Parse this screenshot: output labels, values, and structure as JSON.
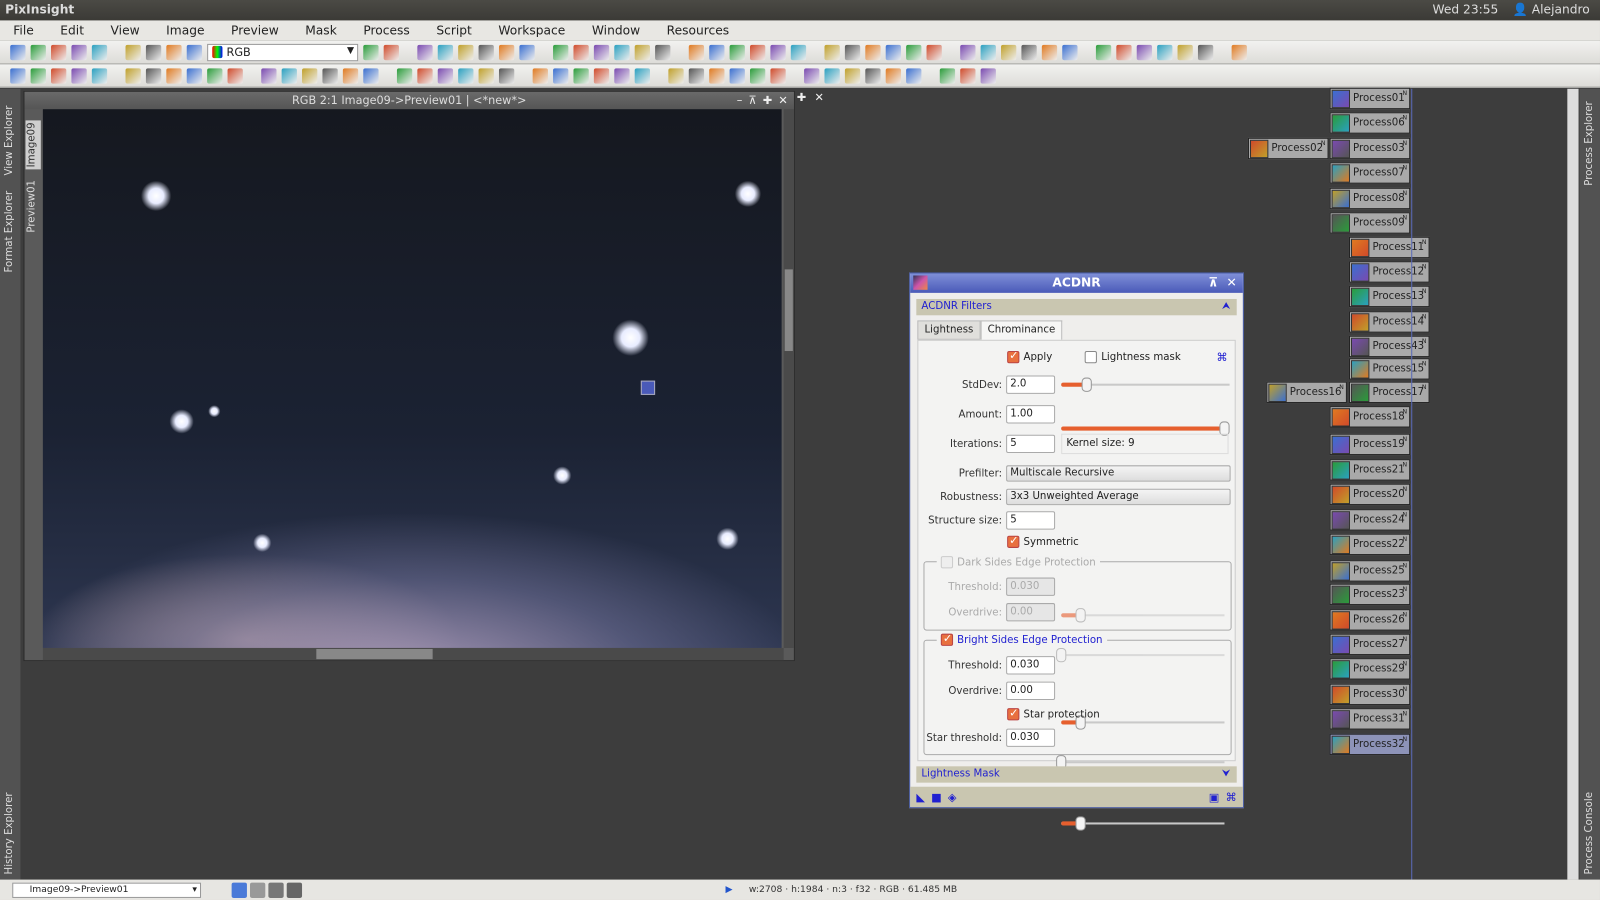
{
  "topbar": {
    "app_title": "PixInsight",
    "clock": "Wed 23:55",
    "user": "Alejandro"
  },
  "menu": [
    "File",
    "Edit",
    "View",
    "Image",
    "Preview",
    "Mask",
    "Process",
    "Script",
    "Workspace",
    "Window",
    "Resources"
  ],
  "toolbar": {
    "color_space_select": "RGB"
  },
  "left_panels": {
    "view_explorer": "View Explorer",
    "format_explorer": "Format Explorer",
    "history_explorer": "History Explorer",
    "tab_image": "Image09",
    "tab_preview": "Preview01"
  },
  "right_panels": {
    "process_explorer": "Process Explorer",
    "process_console": "Process Console"
  },
  "image_window": {
    "title": "RGB 2:1 Image09->Preview01 | <*new*>"
  },
  "acdnr": {
    "title": "ACDNR",
    "filters_section": "ACDNR Filters",
    "tabs": [
      "Lightness",
      "Chrominance"
    ],
    "active_tab": "Chrominance",
    "apply_label": "Apply",
    "apply": true,
    "lightness_mask_label": "Lightness mask",
    "lightness_mask": false,
    "stddev_label": "StdDev:",
    "stddev": "2.0",
    "stddev_pct": 15,
    "amount_label": "Amount:",
    "amount": "1.00",
    "amount_pct": 100,
    "iterations_label": "Iterations:",
    "iterations": "5",
    "kernel_size": "Kernel size: 9",
    "prefilter_label": "Prefilter:",
    "prefilter": "Multiscale Recursive",
    "robustness_label": "Robustness:",
    "robustness": "3x3 Unweighted Average",
    "structure_label": "Structure size:",
    "structure": "5",
    "symmetric_label": "Symmetric",
    "symmetric": true,
    "dark": {
      "label": "Dark Sides Edge Protection",
      "enabled": true,
      "disabled_state": true,
      "threshold_label": "Threshold:",
      "threshold": "0.030",
      "threshold_pct": 12,
      "overdrive_label": "Overdrive:",
      "overdrive": "0.00",
      "overdrive_pct": 0
    },
    "bright": {
      "label": "Bright Sides Edge Protection",
      "enabled": true,
      "threshold_label": "Threshold:",
      "threshold": "0.030",
      "threshold_pct": 12,
      "overdrive_label": "Overdrive:",
      "overdrive": "0.00",
      "overdrive_pct": 0,
      "star_protection_label": "Star protection",
      "star_protection": true,
      "star_threshold_label": "Star threshold:",
      "star_threshold": "0.030",
      "star_threshold_pct": 12
    },
    "lightness_mask_section": "Lightness Mask"
  },
  "process_icons": [
    "Process01",
    "Process06",
    "Process02",
    "Process03",
    "Process07",
    "Process08",
    "Process09",
    "Process11",
    "Process12",
    "Process13",
    "Process14",
    "Process43",
    "Process15",
    "Process16",
    "Process17",
    "Process18",
    "Process19",
    "Process21",
    "Process20",
    "Process24",
    "Process22",
    "Process25",
    "Process23",
    "Process26",
    "Process27",
    "Process29",
    "Process30",
    "Process31",
    "Process32"
  ],
  "statusbar": {
    "view_select": "Image09->Preview01",
    "info": "w:2708 · h:1984 · n:3 · f32 · RGB · 61.485 MB"
  },
  "colors": {
    "accent": "#e65f2e",
    "titlebar": "#4a5ab8",
    "section_text": "#2121d0"
  }
}
